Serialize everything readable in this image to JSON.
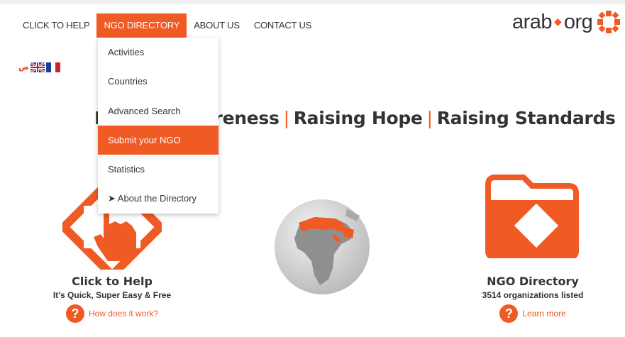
{
  "nav": {
    "items": [
      {
        "label": "CLICK TO HELP",
        "name": "nav-click-to-help",
        "active": false
      },
      {
        "label": "NGO DIRECTORY",
        "name": "nav-ngo-directory",
        "active": true
      },
      {
        "label": "ABOUT US",
        "name": "nav-about-us",
        "active": false
      },
      {
        "label": "CONTACT US",
        "name": "nav-contact-us",
        "active": false
      }
    ]
  },
  "logo": {
    "text_left": "arab",
    "text_right": "org",
    "accent": "#f05a24"
  },
  "languages": {
    "arabic_glyph": "ض"
  },
  "tagline": {
    "part1": "Raising Awareness",
    "part2": "Raising Hope",
    "part3": "Raising Standards",
    "separator": "|"
  },
  "dropdown": {
    "items": [
      {
        "label": "Activities",
        "highlighted": false
      },
      {
        "label": "Countries",
        "highlighted": false
      },
      {
        "label": "Advanced Search",
        "highlighted": false
      },
      {
        "label": "Submit your NGO",
        "highlighted": true
      },
      {
        "label": "Statistics",
        "highlighted": false
      },
      {
        "label": "➤ About the Directory",
        "highlighted": false
      }
    ]
  },
  "click_to_help": {
    "title": "Click to Help",
    "subtitle": "It's Quick, Super Easy & Free",
    "link": "How does it work?",
    "badge": "?"
  },
  "ngo_directory": {
    "title": "NGO Directory",
    "subtitle": "3514 organizations listed",
    "link": "Learn more",
    "badge": "?"
  },
  "colors": {
    "accent": "#f05a24",
    "text": "#333333"
  }
}
